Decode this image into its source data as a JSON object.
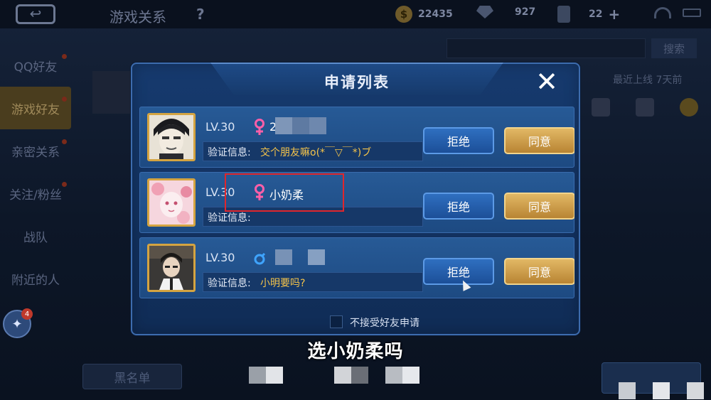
{
  "topbar": {
    "back_icon": "back-arrow-icon",
    "title": "游戏关系",
    "help": "?",
    "gold": "22435",
    "diamonds": "927",
    "cards": "22",
    "plus": "+"
  },
  "sidebar": {
    "items": [
      {
        "label": "QQ好友"
      },
      {
        "label": "游戏好友"
      },
      {
        "label": "亲密关系"
      },
      {
        "label": "关注/粉丝"
      },
      {
        "label": "战队"
      },
      {
        "label": "附近的人"
      }
    ],
    "badge_count": "4",
    "badge_icon": "sparkle-icon"
  },
  "background": {
    "search_label": "搜索",
    "last_online": "最近上线 7天前",
    "blacklist_label": "黑名单"
  },
  "modal": {
    "title": "申请列表",
    "close_label": "✕",
    "verify_label": "验证信息:",
    "refuse_label": "拒绝",
    "accept_label": "同意",
    "requests": [
      {
        "level": "LV.30",
        "gender": "female",
        "nickname": "2",
        "message": "交个朋友嘛o(*￣▽￣*)ブ"
      },
      {
        "level": "LV.30",
        "gender": "female",
        "nickname": "小奶柔",
        "message": ""
      },
      {
        "level": "LV.30",
        "gender": "male",
        "nickname": "",
        "message": "小明要吗?"
      }
    ],
    "footer_label": "不接受好友申请"
  },
  "subtitle": "选小奶柔吗",
  "colors": {
    "modal_bg": "#163a6e",
    "accept_gold": "#e2b865",
    "refuse_blue": "#2f6fc0",
    "highlight_red": "#e0262c",
    "message_gold": "#f4c34a"
  }
}
